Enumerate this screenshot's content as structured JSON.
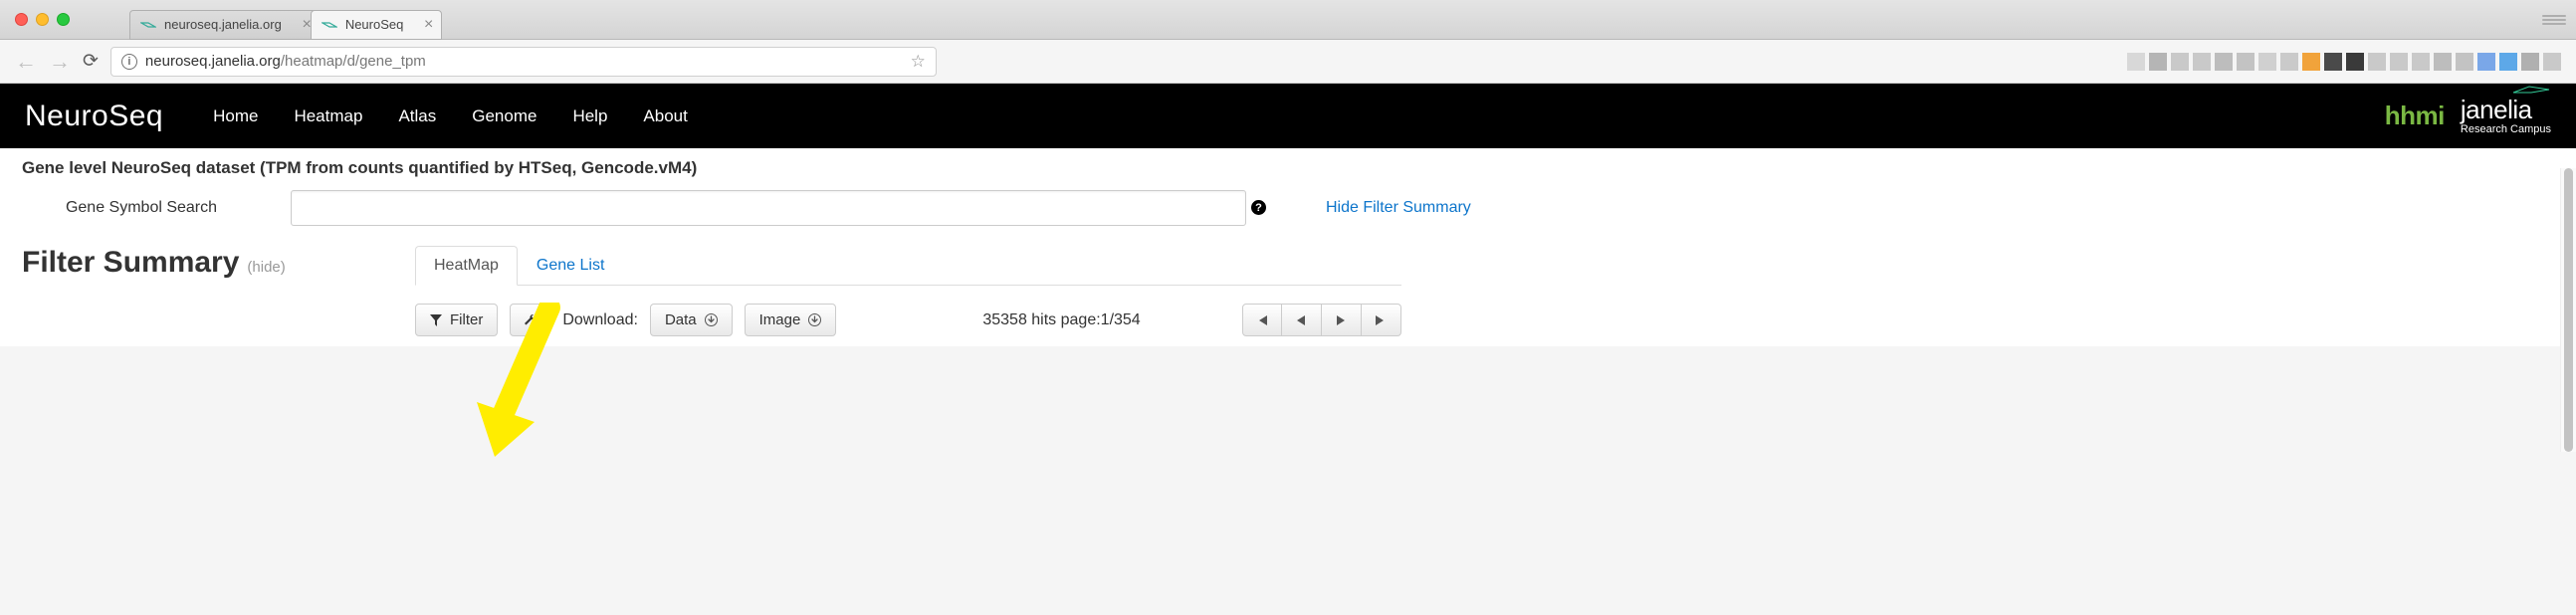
{
  "browser": {
    "tabs": [
      {
        "title": "neuroseq.janelia.org",
        "active": false
      },
      {
        "title": "NeuroSeq",
        "active": true
      }
    ],
    "url_host": "neuroseq.janelia.org",
    "url_path": "/heatmap/d/gene_tpm"
  },
  "navbar": {
    "brand": "NeuroSeq",
    "links": [
      "Home",
      "Heatmap",
      "Atlas",
      "Genome",
      "Help",
      "About"
    ],
    "hhmi": "hhmi",
    "janelia": "janelia",
    "janelia_sub": "Research Campus"
  },
  "page": {
    "description": "Gene level NeuroSeq dataset (TPM from counts quantified by HTSeq, Gencode.vM4)",
    "search_label": "Gene Symbol Search",
    "hide_filter_link": "Hide Filter Summary",
    "filter_summary_title": "Filter Summary",
    "filter_summary_hide": "(hide)",
    "tabs": [
      {
        "label": "HeatMap",
        "active": true
      },
      {
        "label": "Gene List",
        "active": false
      }
    ],
    "toolbar": {
      "filter_label": "Filter",
      "download_label": "Download:",
      "data_btn": "Data",
      "image_btn": "Image"
    },
    "hits_text": "35358 hits page:1/354"
  },
  "ext_colors": [
    "#d8d8d8",
    "#b5b5b5",
    "#c9c9c9",
    "#c9c9c9",
    "#bdbdbd",
    "#c3c3c3",
    "#d0d0d0",
    "#cacaca",
    "#f1a33b",
    "#4a4a4a",
    "#3a3a3a",
    "#c9c9c9",
    "#c9c9c9",
    "#c9c9c9",
    "#bdbdbd",
    "#c3c3c3",
    "#7aa7e8",
    "#5da8e8",
    "#b0b0b0",
    "#c9c9c9"
  ]
}
